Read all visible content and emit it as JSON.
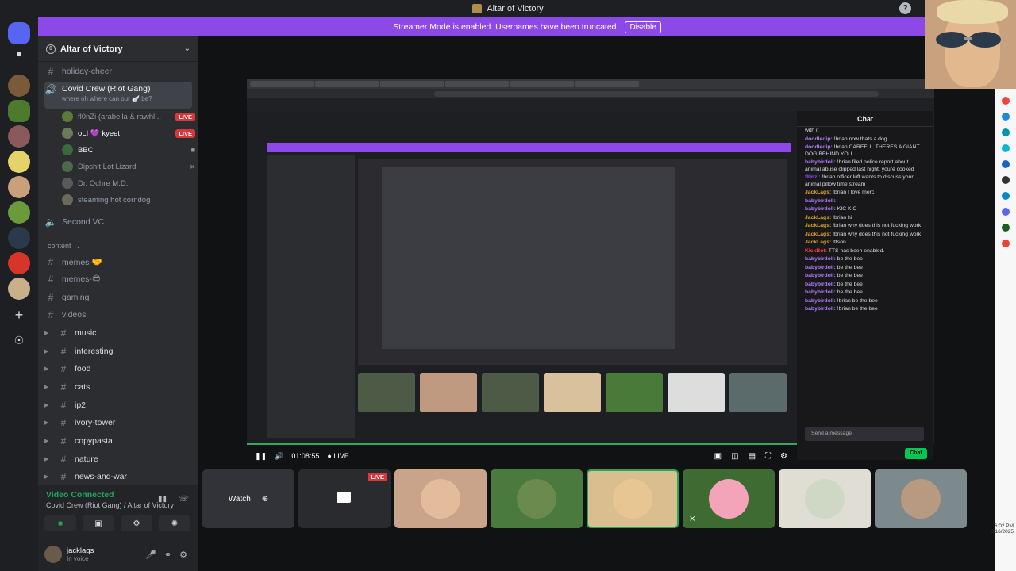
{
  "window": {
    "title": "Altar of Victory"
  },
  "banner": {
    "text": "Streamer Mode is enabled. Usernames have been truncated.",
    "button": "Disable"
  },
  "server": {
    "name": "Altar of Victory",
    "badge": "0"
  },
  "channels": {
    "holiday": "holiday-cheer",
    "voice_active": "Covid Crew (Riot Gang)",
    "voice_status": "where oh where can our 🪽 be?",
    "voice_members": [
      {
        "name": "fl0nZi (arabella & rawhl...",
        "live": "LIVE"
      },
      {
        "name": "oLI 💜 kyeet",
        "live": "LIVE"
      },
      {
        "name": "BBC",
        "live": ""
      },
      {
        "name": "Dipshit Lot Lizard",
        "live": ""
      },
      {
        "name": "Dr. Ochre M.D.",
        "live": ""
      },
      {
        "name": "steaming hot corndog",
        "live": ""
      }
    ],
    "second_vc": "Second VC",
    "category": "content",
    "memes1": "memes-🤝",
    "memes2": "memes-😎",
    "gaming": "gaming",
    "videos": "videos",
    "text_channels": [
      "music",
      "interesting",
      "food",
      "cats",
      "ip2",
      "ivory-tower",
      "copypasta",
      "nature",
      "news-and-war"
    ]
  },
  "voice_panel": {
    "status": "Video Connected",
    "location": "Covid Crew (Riot Gang) / Altar of Victory"
  },
  "user": {
    "name": "jacklags",
    "status": "In voice"
  },
  "player": {
    "time": "01:08:55",
    "live": "LIVE"
  },
  "watch": {
    "label": "Watch"
  },
  "tile_live": "LIVE",
  "chat": {
    "title": "Chat",
    "messages": [
      {
        "user": "",
        "text": "with it",
        "color": "#dcdce0"
      },
      {
        "user": "doodledip:",
        "text": " !brian now thats a dog",
        "color": "#b57cff"
      },
      {
        "user": "doodledip:",
        "text": " !brian CAREFUL THERES A GIANT DOG BEHIND YOU",
        "color": "#b57cff"
      },
      {
        "user": "babybirdoll:",
        "text": " !brian filed police report about animal abuse clipped last night. youre cooked",
        "color": "#b57cff"
      },
      {
        "user": "fl0nzi:",
        "text": " !brian officer luft wants to discuss your animal pillow time stream",
        "color": "#9146ff"
      },
      {
        "user": "JackLags:",
        "text": " !brian I love merc",
        "color": "#daa520"
      },
      {
        "user": "babybirdoll:",
        "text": "",
        "color": "#b57cff"
      },
      {
        "user": "babybirdoll:",
        "text": " KIC KIC",
        "color": "#b57cff"
      },
      {
        "user": "JackLags:",
        "text": " !brian hi",
        "color": "#daa520"
      },
      {
        "user": "JackLags:",
        "text": " !brian why does this not fucking work",
        "color": "#daa520"
      },
      {
        "user": "JackLags:",
        "text": " !brian why does this not fucking work",
        "color": "#daa520"
      },
      {
        "user": "JackLags:",
        "text": " !ttson",
        "color": "#daa520"
      },
      {
        "user": "KickBot:",
        "text": " TTS has been enabled.",
        "color": "#ff4040"
      },
      {
        "user": "babybirdoll:",
        "text": " be the bee",
        "color": "#b57cff"
      },
      {
        "user": "babybirdoll:",
        "text": " be the bee",
        "color": "#b57cff"
      },
      {
        "user": "babybirdoll:",
        "text": " be the bee",
        "color": "#b57cff"
      },
      {
        "user": "babybirdoll:",
        "text": " be the bee",
        "color": "#b57cff"
      },
      {
        "user": "babybirdoll:",
        "text": " be the bee",
        "color": "#b57cff"
      },
      {
        "user": "babybirdoll:",
        "text": " !brian be the bee",
        "color": "#b57cff"
      },
      {
        "user": "babybirdoll:",
        "text": " !brian be the bee",
        "color": "#b57cff"
      }
    ],
    "input_placeholder": "Send a message",
    "button": "Chat"
  },
  "clock": {
    "time": "6:02 PM",
    "date": "8/16/2025"
  },
  "colors": {
    "accent": "#8d49e8",
    "live": "#da373c",
    "connected": "#23a55a"
  }
}
